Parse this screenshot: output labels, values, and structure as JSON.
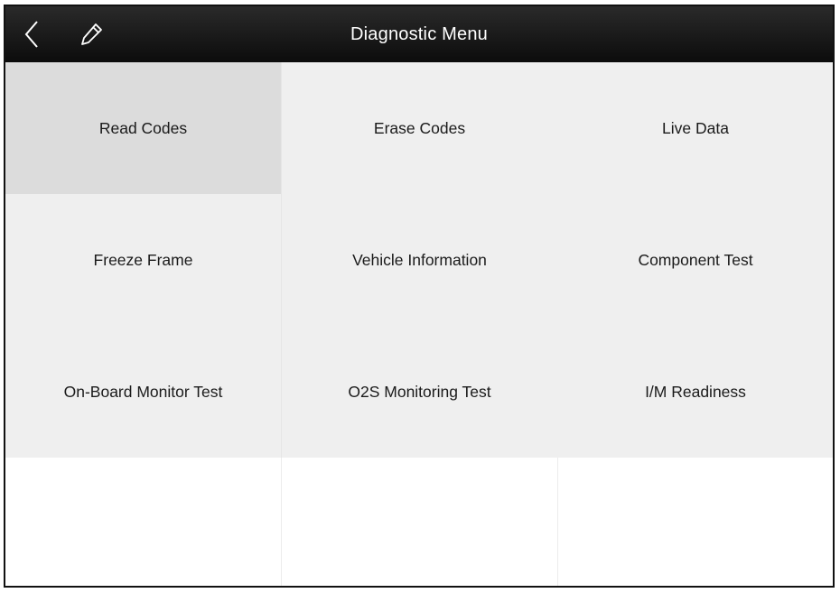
{
  "header": {
    "title": "Diagnostic Menu",
    "back_icon": "chevron-left-icon",
    "edit_icon": "pencil-icon"
  },
  "colors": {
    "titlebar": "#111111",
    "tile": "#efefef",
    "tile_selected": "#dcdcdc",
    "text": "#1a1a1a"
  },
  "menu": {
    "selected_index": 0,
    "items": [
      {
        "label": "Read Codes"
      },
      {
        "label": "Erase Codes"
      },
      {
        "label": "Live Data"
      },
      {
        "label": "Freeze Frame"
      },
      {
        "label": "Vehicle Information"
      },
      {
        "label": "Component Test"
      },
      {
        "label": "On-Board Monitor Test"
      },
      {
        "label": "O2S Monitoring Test"
      },
      {
        "label": "I/M Readiness"
      }
    ]
  }
}
